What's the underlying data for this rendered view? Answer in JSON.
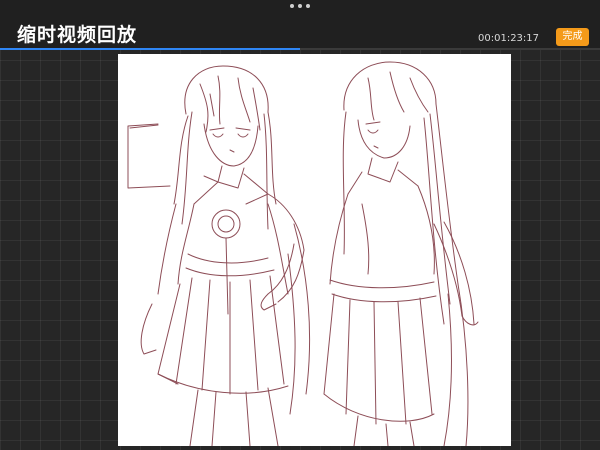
{
  "header": {
    "title": "缩时视频回放",
    "timestamp": "00:01:23:17",
    "done_label": "完成",
    "more_icon": "ellipsis-icon"
  },
  "playback": {
    "progress_fraction": 0.5
  },
  "colors": {
    "accent_blue": "#2f86f5",
    "done_orange": "#f49a1a",
    "sketch_ink": "#7a2f3a"
  }
}
